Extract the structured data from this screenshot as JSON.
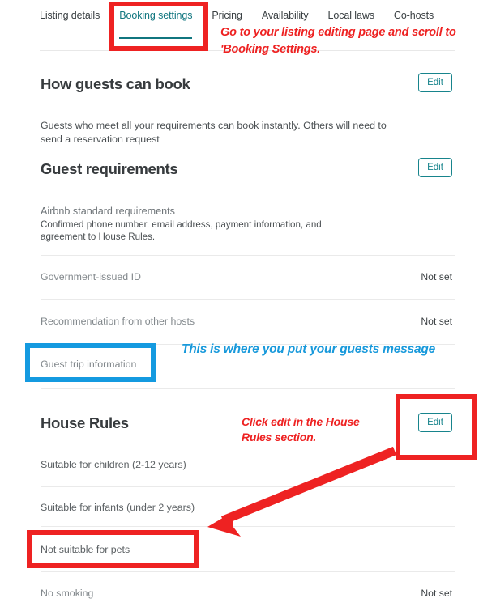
{
  "tabs": [
    {
      "label": "Listing details",
      "active": false
    },
    {
      "label": "Booking settings",
      "active": true
    },
    {
      "label": "Pricing",
      "active": false
    },
    {
      "label": "Availability",
      "active": false
    },
    {
      "label": "Local laws",
      "active": false
    },
    {
      "label": "Co-hosts",
      "active": false
    }
  ],
  "sections": {
    "how_guests_can_book": {
      "title": "How guests can book",
      "edit_label": "Edit",
      "description": "Guests who meet all your requirements can book instantly. Others will need to send a reservation request"
    },
    "guest_requirements": {
      "title": "Guest requirements",
      "edit_label": "Edit",
      "standard_title": "Airbnb standard requirements",
      "standard_desc": "Confirmed phone number, email address, payment information, and agreement to House Rules.",
      "rows": [
        {
          "label": "Government-issued ID",
          "value": "Not set"
        },
        {
          "label": "Recommendation from other hosts",
          "value": "Not set"
        },
        {
          "label": "Guest trip information",
          "value": ""
        }
      ]
    },
    "house_rules": {
      "title": "House Rules",
      "edit_label": "Edit",
      "rows": [
        {
          "label": "Suitable for children (2-12 years)",
          "value": ""
        },
        {
          "label": "Suitable for infants (under 2 years)",
          "value": ""
        },
        {
          "label": "Not suitable for pets",
          "value": ""
        },
        {
          "label": "No smoking",
          "value": "Not set"
        }
      ]
    }
  },
  "annotations": {
    "top_note": "Go to your listing editing page and scroll to 'Booking Settings.",
    "guest_trip_note": "This is where you put your guests message",
    "house_rules_note": "Click edit in the House Rules section."
  },
  "colors": {
    "accent_teal": "#17848c",
    "annotation_red": "#ee2222",
    "annotation_blue": "#1899db"
  }
}
